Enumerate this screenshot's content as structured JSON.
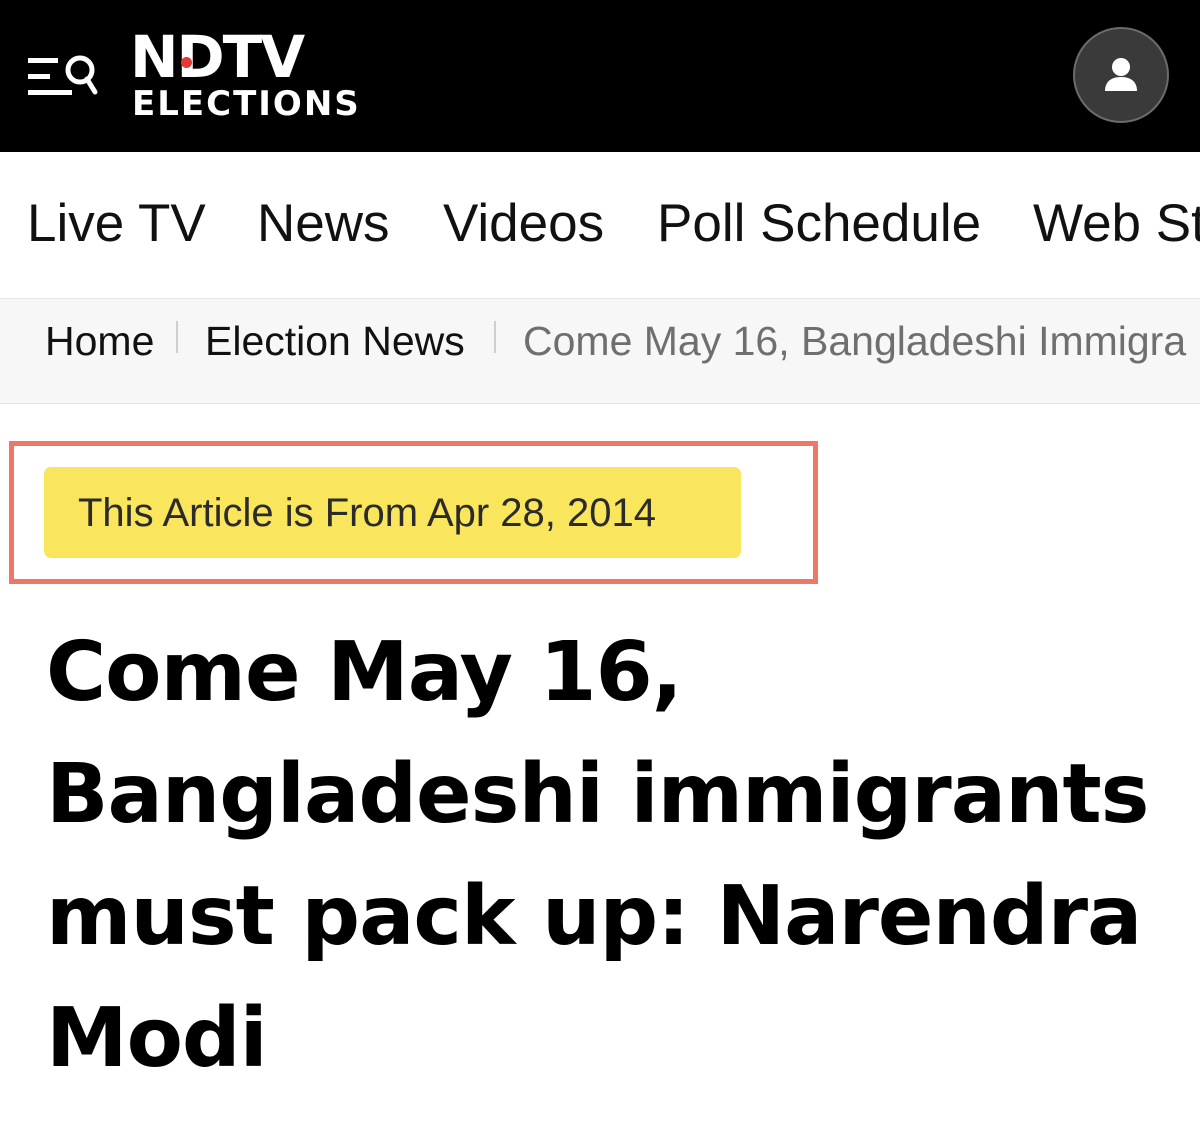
{
  "header": {
    "menu_search_icon": "menu-search-icon",
    "logo": {
      "main": "NDTV",
      "sub": "ELECTIONS",
      "accent_color": "#e53935"
    },
    "account_icon": "user-icon",
    "background_color": "#000000"
  },
  "nav": {
    "items": [
      {
        "label": "Live TV"
      },
      {
        "label": "News"
      },
      {
        "label": "Videos"
      },
      {
        "label": "Poll Schedule"
      },
      {
        "label": "Web St"
      }
    ]
  },
  "breadcrumb": {
    "items": [
      {
        "label": "Home"
      },
      {
        "label": "Election News"
      },
      {
        "label": "Come May 16, Bangladeshi Immigra"
      }
    ]
  },
  "article": {
    "date_notice": "This Article is From Apr 28, 2014",
    "date_notice_color": "#f9e65c",
    "highlight_color": "#ee7767",
    "headline": "Come May 16, Bangladeshi immigrants must pack up: Narendra Modi"
  }
}
